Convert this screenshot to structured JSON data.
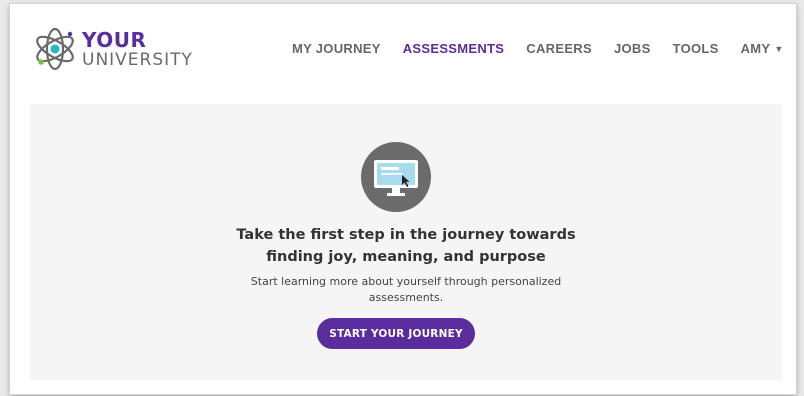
{
  "brand": {
    "line1": "YOUR",
    "line2": "UNIVERSITY",
    "colors": {
      "purple": "#5b2c9e",
      "teal": "#23b8c4",
      "green": "#7ac143",
      "gray": "#6a6a6a"
    }
  },
  "nav": {
    "items": [
      {
        "label": "MY JOURNEY"
      },
      {
        "label": "ASSESSMENTS",
        "active": true
      },
      {
        "label": "CAREERS"
      },
      {
        "label": "JOBS"
      },
      {
        "label": "TOOLS"
      }
    ],
    "user_label": "AMY"
  },
  "hero": {
    "icon": "computer-monitor-icon",
    "title_line1": "Take the first step in the journey towards",
    "title_line2": "finding joy, meaning, and purpose",
    "subtitle_line1": "Start learning more about yourself through personalized",
    "subtitle_line2": "assessments.",
    "cta_label": "START YOUR JOURNEY"
  }
}
